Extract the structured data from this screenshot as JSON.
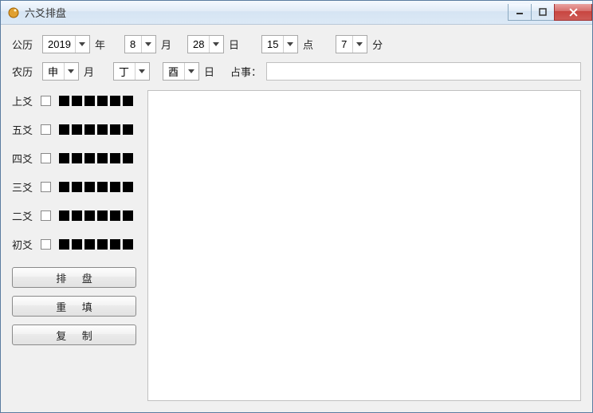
{
  "window": {
    "title": "六爻排盘"
  },
  "gregorian": {
    "label": "公历",
    "year": "2019",
    "year_suffix": "年",
    "month": "8",
    "month_suffix": "月",
    "day": "28",
    "day_suffix": "日",
    "hour": "15",
    "hour_suffix": "点",
    "minute": "7",
    "minute_suffix": "分"
  },
  "lunar": {
    "label": "农历",
    "month": "申",
    "month_suffix": "月",
    "stem": "丁",
    "branch": "酉",
    "day_suffix": "日",
    "zhan_label": "占事：",
    "zhan_value": ""
  },
  "yao_rows": [
    {
      "label": "上爻"
    },
    {
      "label": "五爻"
    },
    {
      "label": "四爻"
    },
    {
      "label": "三爻"
    },
    {
      "label": "二爻"
    },
    {
      "label": "初爻"
    }
  ],
  "buttons": {
    "paipan": "排 盘",
    "reset": "重 填",
    "copy": "复 制"
  },
  "result_text": ""
}
